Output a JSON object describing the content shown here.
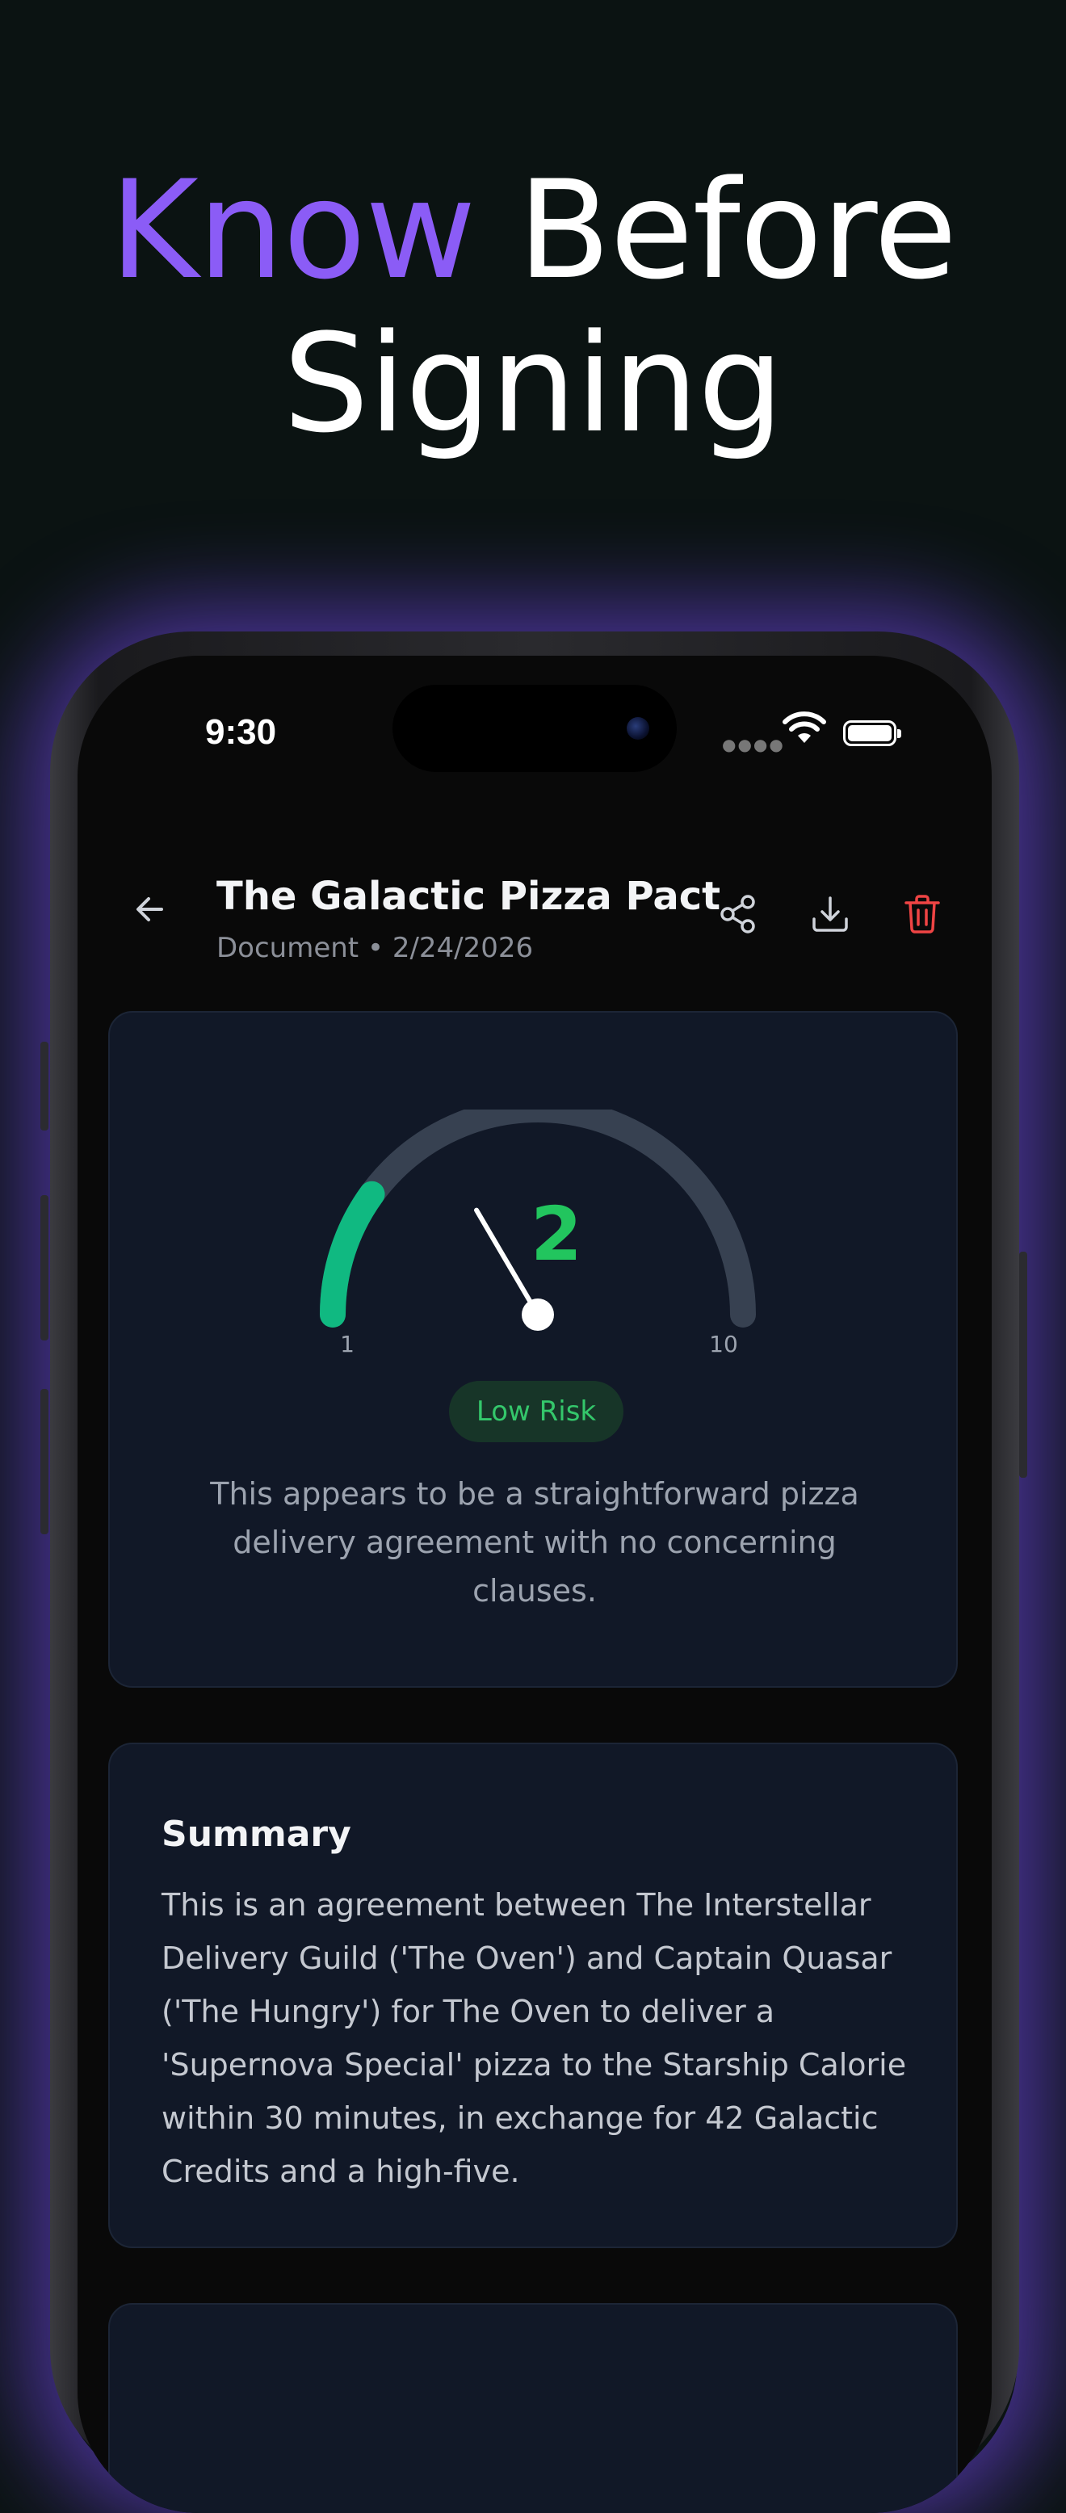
{
  "headline": {
    "accent": "Know",
    "rest": " Before",
    "line2": "Signing"
  },
  "status": {
    "time": "9:30"
  },
  "document": {
    "title": "The Galactic Pizza Pact",
    "meta": "Document • 2/24/2026"
  },
  "risk": {
    "score": "2",
    "min_label": "1",
    "max_label": "10",
    "score_value": 2,
    "scale_min": 1,
    "scale_max": 10,
    "level": "Low Risk",
    "description": "This appears to be a straightforward pizza delivery agreement with no concerning clauses.",
    "colors": {
      "fill": "#10b981",
      "track": "#374151",
      "score": "#22c55e"
    }
  },
  "summary": {
    "title": "Summary",
    "text": "This is an agreement between The Interstellar Delivery Guild ('The Oven') and Captain Quasar ('The Hungry') for The Oven to deliver a 'Supernova Special' pizza to the Starship Calorie within 30 minutes, in exchange for 42 Galactic Credits and a high-five."
  },
  "colors": {
    "accent": "#8b5cf6",
    "delete": "#ef4444"
  }
}
